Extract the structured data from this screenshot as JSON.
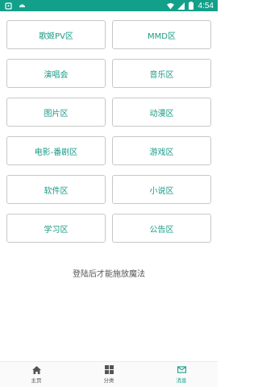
{
  "status_bar": {
    "time": "4:54",
    "bg_color": "#13a08a",
    "left_icons": [
      "notification-icon",
      "android-icon"
    ],
    "right_icons": [
      "wifi-icon",
      "signal-icon",
      "battery-icon"
    ]
  },
  "categories": [
    {
      "label": "歌姬PV区"
    },
    {
      "label": "MMD区"
    },
    {
      "label": "演唱会"
    },
    {
      "label": "音乐区"
    },
    {
      "label": "图片区"
    },
    {
      "label": "动漫区"
    },
    {
      "label": "电影-番剧区"
    },
    {
      "label": "游戏区"
    },
    {
      "label": "软件区"
    },
    {
      "label": "小说区"
    },
    {
      "label": "学习区"
    },
    {
      "label": "公告区"
    }
  ],
  "login_hint": "登陆后才能施放魔法",
  "tabbar": {
    "items": [
      {
        "label": "主页",
        "icon": "home-icon"
      },
      {
        "label": "分类",
        "icon": "grid-icon"
      },
      {
        "label": "消息",
        "icon": "mail-icon",
        "active": true
      }
    ],
    "accent": "#13a08a"
  }
}
